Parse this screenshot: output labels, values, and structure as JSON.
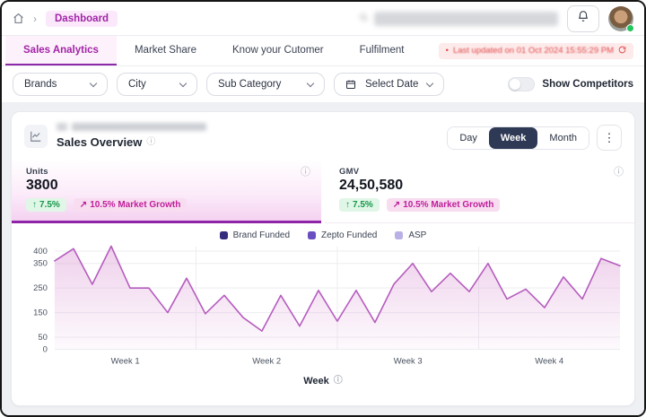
{
  "theme": {
    "accent_purple": "#a224a8",
    "selected_dark": "#2e3a55",
    "positive_green": "#17984a",
    "growth_pink": "#bf1f9a",
    "alert_red": "#e14949",
    "stat_underline": "#9024a6"
  },
  "header": {
    "breadcrumb": {
      "page": "Dashboard"
    },
    "search": {
      "redacted": true
    },
    "avatar_status": "online"
  },
  "tabs": {
    "items": [
      {
        "label": "Sales Analytics",
        "active": true
      },
      {
        "label": "Market Share",
        "active": false
      },
      {
        "label": "Know your Cutomer",
        "active": false
      },
      {
        "label": "Fulfilment",
        "active": false
      }
    ],
    "last_updated": "Last updated on 01 Oct 2024 15:55:29 PM"
  },
  "filters": {
    "dropdowns": [
      {
        "label": "Brands"
      },
      {
        "label": "City"
      },
      {
        "label": "Sub Category"
      },
      {
        "label": "Select Date",
        "icon": "calendar-icon"
      }
    ],
    "show_competitors": {
      "label": "Show Competitors",
      "enabled": false
    }
  },
  "overview": {
    "title": "Sales Overview",
    "range_options": [
      {
        "label": "Day",
        "active": false
      },
      {
        "label": "Week",
        "active": true
      },
      {
        "label": "Month",
        "active": false
      }
    ],
    "stats": [
      {
        "label": "Units",
        "value": "3800",
        "change": "7.5%",
        "change_dir": "up",
        "market_growth": "10.5% Market Growth",
        "selected": true
      },
      {
        "label": "GMV",
        "value": "24,50,580",
        "change": "7.5%",
        "change_dir": "up",
        "market_growth": "10.5% Market Growth",
        "selected": false
      }
    ],
    "arrows": {
      "up": "↑",
      "trend": "↗"
    }
  },
  "chart_data": {
    "type": "area",
    "title": "Sales Overview",
    "xlabel": "Week",
    "ylabel": "",
    "x_category_labels": [
      "Week 1",
      "Week 2",
      "Week 3",
      "Week 4"
    ],
    "y_ticks": [
      0,
      50,
      150,
      250,
      350,
      400
    ],
    "ylim": [
      0,
      440
    ],
    "grid": true,
    "legend_position": "top-center",
    "legend": [
      {
        "name": "Brand Funded",
        "color": "#352c7e"
      },
      {
        "name": "Zepto Funded",
        "color": "#6a4fc0"
      },
      {
        "name": "ASP",
        "color": "#b9b0e6"
      }
    ],
    "series": [
      {
        "name": "",
        "color": "#b55cbe",
        "fill_top": "#dd9ed6",
        "values": [
          360,
          410,
          265,
          420,
          250,
          250,
          150,
          290,
          145,
          220,
          130,
          75,
          220,
          95,
          240,
          115,
          240,
          110,
          265,
          350,
          235,
          310,
          235,
          350,
          205,
          245,
          170,
          295,
          205,
          370,
          340
        ]
      }
    ]
  }
}
